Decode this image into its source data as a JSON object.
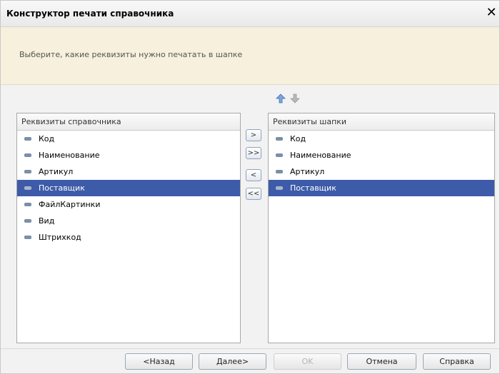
{
  "window": {
    "title": "Конструктор печати справочника"
  },
  "banner": {
    "text": "Выберите, какие реквизиты нужно печатать в шапке"
  },
  "toolbar": {
    "up_icon": "arrow-up-icon",
    "down_icon": "arrow-down-icon"
  },
  "left_list": {
    "header": "Реквизиты справочника",
    "items": [
      "Код",
      "Наименование",
      "Артикул",
      "Поставщик",
      "ФайлКартинки",
      "Вид",
      "Штрихкод"
    ],
    "selected": "Поставщик"
  },
  "right_list": {
    "header": "Реквизиты шапки",
    "items": [
      "Код",
      "Наименование",
      "Артикул",
      "Поставщик"
    ],
    "selected": "Поставщик"
  },
  "move_buttons": {
    "add": ">",
    "add_all": ">>",
    "remove": "<",
    "remove_all": "<<"
  },
  "footer": {
    "back": "<Назад",
    "next": "Далее>",
    "ok": "OK",
    "cancel": "Отмена",
    "help": "Справка"
  },
  "colors": {
    "selection": "#3d5ba8",
    "banner": "#f6f0dc"
  }
}
